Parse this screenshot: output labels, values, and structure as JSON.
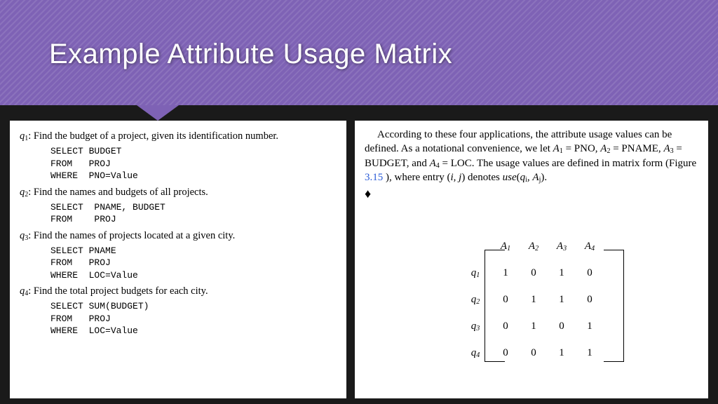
{
  "title": "Example Attribute Usage Matrix",
  "queries": [
    {
      "label": "q",
      "sub": "1",
      "desc": ": Find the budget of a project, given its identification number.",
      "sql": "SELECT BUDGET\nFROM   PROJ\nWHERE  PNO=Value"
    },
    {
      "label": "q",
      "sub": "2",
      "desc": ": Find the names and budgets of all projects.",
      "sql": "SELECT  PNAME, BUDGET\nFROM    PROJ"
    },
    {
      "label": "q",
      "sub": "3",
      "desc": ": Find the names of projects located at a given city.",
      "sql": "SELECT PNAME\nFROM   PROJ\nWHERE  LOC=Value"
    },
    {
      "label": "q",
      "sub": "4",
      "desc": ": Find the total project budgets for each city.",
      "sql": "SELECT SUM(BUDGET)\nFROM   PROJ\nWHERE  LOC=Value"
    }
  ],
  "paragraph": {
    "lead": "According to these four applications, the attribute usage values can be defined. As a notational convenience, we let ",
    "a1": "A",
    "a1sub": "1",
    "a1eq": " = PNO, ",
    "a2": "A",
    "a2sub": "2",
    "a2eq": " = PNAME, ",
    "a3": "A",
    "a3sub": "3",
    "a3eq": " = BUDGET, and ",
    "a4": "A",
    "a4sub": "4",
    "a4eq": " = LOC. The usage values are defined in matrix form (Figure ",
    "figref": "3.15",
    "tail1": "), where entry (",
    "ij_i": "i",
    "ij_comma": ", ",
    "ij_j": "j",
    "tail2": ") denotes ",
    "use": "use",
    "use_open": "(",
    "qi": "q",
    "qisub": "i",
    "comma2": ", ",
    "Aj": "A",
    "Ajsub": "j",
    "use_close": ").",
    "diamond": "♦"
  },
  "matrix": {
    "col_headers": [
      {
        "l": "A",
        "s": "1"
      },
      {
        "l": "A",
        "s": "2"
      },
      {
        "l": "A",
        "s": "3"
      },
      {
        "l": "A",
        "s": "4"
      }
    ],
    "row_headers": [
      {
        "l": "q",
        "s": "1"
      },
      {
        "l": "q",
        "s": "2"
      },
      {
        "l": "q",
        "s": "3"
      },
      {
        "l": "q",
        "s": "4"
      }
    ],
    "cells": [
      [
        "1",
        "0",
        "1",
        "0"
      ],
      [
        "0",
        "1",
        "1",
        "0"
      ],
      [
        "0",
        "1",
        "0",
        "1"
      ],
      [
        "0",
        "0",
        "1",
        "1"
      ]
    ]
  },
  "chart_data": {
    "type": "table",
    "title": "Attribute Usage Matrix use(q_i, A_j)",
    "columns": [
      "A1 (PNO)",
      "A2 (PNAME)",
      "A3 (BUDGET)",
      "A4 (LOC)"
    ],
    "rows": [
      "q1",
      "q2",
      "q3",
      "q4"
    ],
    "values": [
      [
        1,
        0,
        1,
        0
      ],
      [
        0,
        1,
        1,
        0
      ],
      [
        0,
        1,
        0,
        1
      ],
      [
        0,
        0,
        1,
        1
      ]
    ]
  }
}
